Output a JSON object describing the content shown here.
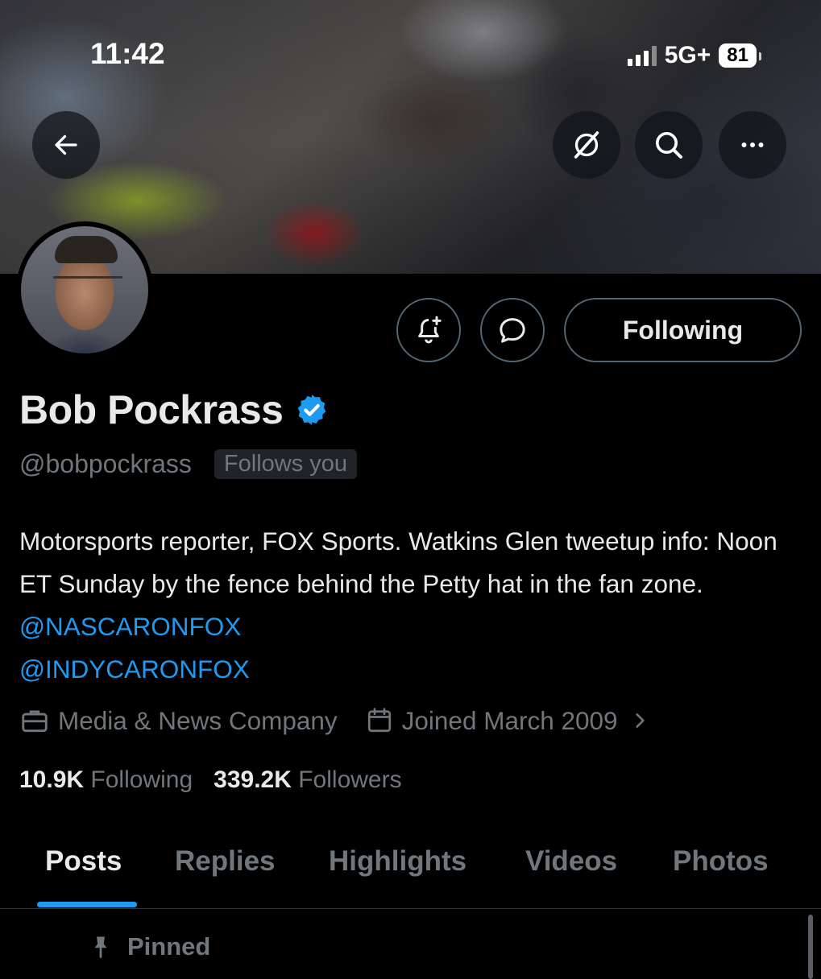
{
  "status_bar": {
    "time": "11:42",
    "network": "5G+",
    "battery": "81"
  },
  "header": {
    "back_icon": "arrow-left-icon",
    "grok_icon": "grok-icon",
    "search_icon": "search-icon",
    "more_icon": "more-dots-icon"
  },
  "profile": {
    "name": "Bob Pockrass",
    "handle": "@bobpockrass",
    "follows_you": "Follows you",
    "bio": {
      "text": "Motorsports reporter, FOX Sports. Watkins Glen tweetup info: Noon ET Sunday by the fence behind the Petty hat in the fan zone. ",
      "link1": "@NASCARONFOX",
      "link2": "@INDYCARONFOX"
    },
    "category": "Media & News Company",
    "joined": "Joined March 2009",
    "following_count": "10.9K",
    "following_label": "Following",
    "followers_count": "339.2K",
    "followers_label": "Followers"
  },
  "actions": {
    "following_button": "Following",
    "notify_icon": "bell-plus-icon",
    "message_icon": "message-bubble-icon"
  },
  "tabs": [
    {
      "label": "Posts",
      "active": true
    },
    {
      "label": "Replies",
      "active": false
    },
    {
      "label": "Highlights",
      "active": false
    },
    {
      "label": "Videos",
      "active": false
    },
    {
      "label": "Photos",
      "active": false
    }
  ],
  "pinned_label": "Pinned",
  "colors": {
    "accent": "#1d9bf0",
    "verified": "#1d9bf0",
    "muted": "#71767b"
  }
}
